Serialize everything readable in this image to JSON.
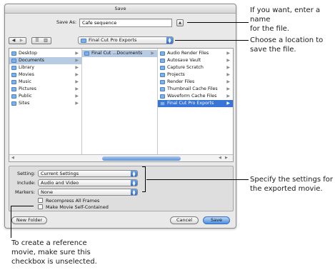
{
  "dialog": {
    "title": "Save",
    "save_as_label": "Save As:",
    "save_as_value": "Cafe sequence",
    "expand_icon": "triangle-icon",
    "location_popup": "Final Cut Pro Exports",
    "view_buttons": [
      "list-view-icon",
      "column-view-icon"
    ],
    "nav_buttons": [
      "back-icon",
      "forward-icon"
    ]
  },
  "browser": {
    "column1": [
      {
        "label": "Desktop",
        "selected": false
      },
      {
        "label": "Documents",
        "selected": true
      },
      {
        "label": "Library",
        "selected": false
      },
      {
        "label": "Movies",
        "selected": false
      },
      {
        "label": "Music",
        "selected": false
      },
      {
        "label": "Pictures",
        "selected": false
      },
      {
        "label": "Public",
        "selected": false
      },
      {
        "label": "Sites",
        "selected": false
      }
    ],
    "column2": [
      {
        "label": "Final Cut ...Documents",
        "selected": true
      }
    ],
    "column3": [
      {
        "label": "Audio Render Files",
        "selected": false
      },
      {
        "label": "Autosave Vault",
        "selected": false
      },
      {
        "label": "Capture Scratch",
        "selected": false
      },
      {
        "label": "Projects",
        "selected": false
      },
      {
        "label": "Render Files",
        "selected": false
      },
      {
        "label": "Thumbnail Cache Files",
        "selected": false
      },
      {
        "label": "Waveform Cache Files",
        "selected": false
      },
      {
        "label": "Final Cut Pro Exports",
        "selected": true
      }
    ]
  },
  "settings": {
    "setting_label": "Setting:",
    "setting_value": "Current Settings",
    "include_label": "Include:",
    "include_value": "Audio and Video",
    "markers_label": "Markers:",
    "markers_value": "None",
    "recompress_label": "Recompress All Frames",
    "self_contained_label": "Make Movie Self-Contained"
  },
  "buttons": {
    "new_folder": "New Folder",
    "cancel": "Cancel",
    "save": "Save"
  },
  "callouts": {
    "name_l1": "If you want, enter a name",
    "name_l2": "for the file.",
    "location_l1": "Choose a location to",
    "location_l2": "save the file.",
    "settings_l1": "Specify the settings for",
    "settings_l2": "the exported movie.",
    "reference_l1": "To create a reference",
    "reference_l2": "movie, make sure this",
    "reference_l3": "checkbox is unselected."
  },
  "colors": {
    "selection_blue": "#3875d7",
    "accent_blue": "#4c8ee2"
  }
}
